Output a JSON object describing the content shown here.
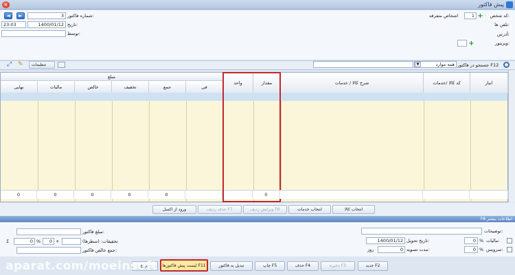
{
  "window": {
    "title": "پیش فاکتور",
    "close": "×"
  },
  "header": {
    "person_code_label": "کد شخص:",
    "person_code_value": "1",
    "person_name_placeholder": "اشخاص متفرقه",
    "phone_label": "تلفن ها:",
    "address_label": "آدرس:",
    "visitor_label": "ویزیتور:",
    "invoice_no_label": "شماره فاکتور:",
    "invoice_no_value": "3",
    "date_label": "تاریخ:",
    "date_value": "1400/01/12",
    "time_value": "23:03",
    "by_label": "توسط:",
    "prev": "◄",
    "next": "►"
  },
  "toolbar": {
    "search_placeholder": "جستجو در فاکتور F12",
    "filter_value": "همه موارد",
    "settings_label": "تنظیمات"
  },
  "grid": {
    "headers": {
      "warehouse": "انبار",
      "code": "کد کالا /خدمات",
      "desc": "شرح کالا / خدمات",
      "qty": "مقدار",
      "unit": "واحد",
      "amount": "مبلغ",
      "fee": "فی",
      "sum": "جمع",
      "discount": "تخفیف",
      "net": "خالص",
      "tax": "مالیات",
      "final": "نهایی"
    },
    "totals": {
      "qty": "0",
      "fee": "0",
      "sum": "0",
      "discount": "0",
      "net": "0",
      "tax": "0",
      "final": "0"
    }
  },
  "actions": {
    "select_goods": "انتخاب کالا",
    "select_services": "انتخاب خدمات",
    "edit_row": "ویرایش ردیف F6",
    "delete_row": "حذف ردیف F7",
    "excel_import": "ورود از اکسل"
  },
  "more_info": {
    "title": "F8 اطلاعات بیشتر",
    "description_label": "توضیحات:",
    "delivery_date_label": "تاریخ تحویل:",
    "delivery_date_value": "1400/01/12",
    "settle_label": "مدت تسویه:",
    "settle_value": "0",
    "settle_unit": "روز",
    "tax_label": "مالیات:",
    "tax_value": "0",
    "service_label": "سرویس:",
    "service_value": "0",
    "percent": "%",
    "invoice_amount_label": "مبلغ فاکتور:",
    "discounts_label": "تخفیفات: (سطرها)",
    "disc_value": "0",
    "net_total_label": "جمع خالص فاکتور:",
    "sigma": "Σ"
  },
  "bottom": {
    "new": "جدید F2",
    "save": "ذخیره F3",
    "delete": "حذف F4",
    "print": "چاپ F5",
    "convert": "تبدیل به فاکتور",
    "list": "لیست پیش فاکتورها F11",
    "exit": "خروج"
  },
  "watermark": "aparat.com/moeinsoft"
}
